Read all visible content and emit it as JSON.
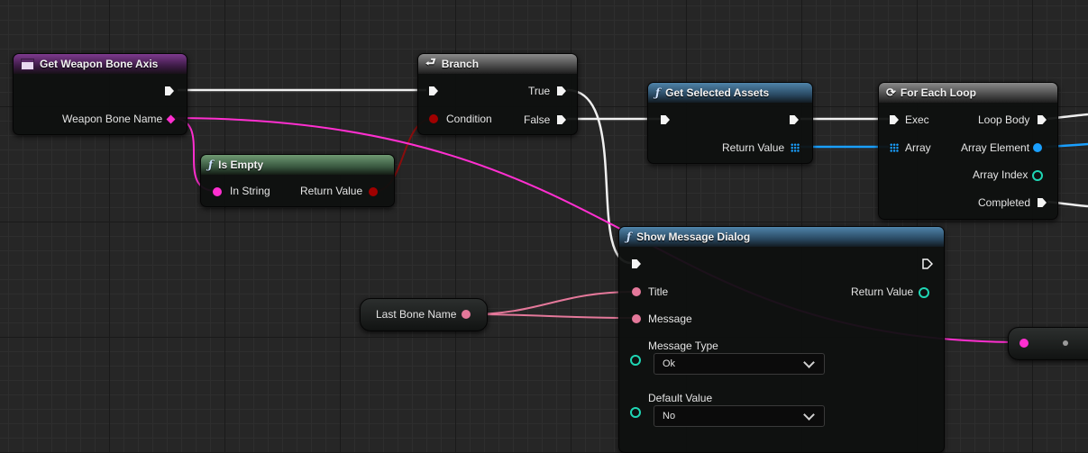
{
  "nodes": {
    "get_weapon_bone_axis": {
      "title": "Get Weapon Bone Axis",
      "pin_weapon_bone_name": "Weapon Bone Name"
    },
    "branch": {
      "title": "Branch",
      "pin_condition": "Condition",
      "pin_true": "True",
      "pin_false": "False"
    },
    "is_empty": {
      "title": "Is Empty",
      "pin_in_string": "In String",
      "pin_return_value": "Return Value"
    },
    "get_selected_assets": {
      "title": "Get Selected Assets",
      "pin_return_value": "Return Value"
    },
    "for_each_loop": {
      "title": "For Each Loop",
      "pin_exec": "Exec",
      "pin_array": "Array",
      "pin_loop_body": "Loop Body",
      "pin_array_element": "Array Element",
      "pin_array_index": "Array Index",
      "pin_completed": "Completed"
    },
    "show_message_dialog": {
      "title": "Show Message Dialog",
      "pin_title": "Title",
      "pin_message": "Message",
      "pin_return_value": "Return Value",
      "message_type_label": "Message Type",
      "message_type_value": "Ok",
      "default_value_label": "Default Value",
      "default_value_value": "No"
    },
    "last_bone_name": {
      "label": "Last Bone Name"
    }
  },
  "icons": {
    "function": "ƒ",
    "branch": "branch-icon",
    "loop": "loop-icon",
    "event": "event-icon"
  },
  "colors": {
    "exec": "#f4f4f4",
    "string_pin": "#ff2fd0",
    "bool_pin": "#a00000",
    "array_pin": "#1aa0ff",
    "int_pin": "#1fd6b4",
    "text_pin": "#e4789a"
  }
}
